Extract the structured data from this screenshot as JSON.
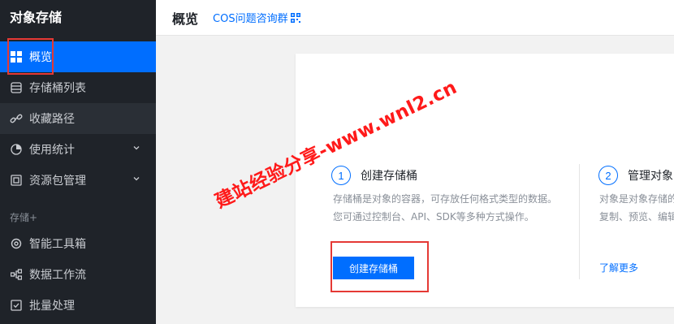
{
  "sidebar": {
    "title": "对象存储",
    "section_label": "存储+",
    "items": [
      {
        "label": "概览",
        "icon": "grid-icon"
      },
      {
        "label": "存储桶列表",
        "icon": "database-icon"
      },
      {
        "label": "收藏路径",
        "icon": "link-icon"
      },
      {
        "label": "使用统计",
        "icon": "pie-chart-icon"
      },
      {
        "label": "资源包管理",
        "icon": "package-icon"
      },
      {
        "label": "智能工具箱",
        "icon": "settings-icon"
      },
      {
        "label": "数据工作流",
        "icon": "workflow-icon"
      },
      {
        "label": "批量处理",
        "icon": "checkbox-icon"
      }
    ]
  },
  "header": {
    "title": "概览",
    "link_label": "COS问题咨询群"
  },
  "steps": [
    {
      "num": "1",
      "title": "创建存储桶",
      "desc_line1": "存储桶是对象的容器，可存放任何格式类型的数据。",
      "desc_line2": "您可通过控制台、API、SDK等多种方式操作。",
      "button_label": "创建存储桶"
    },
    {
      "num": "2",
      "title": "管理对象",
      "desc_line1": "对象是对象存储的",
      "desc_line2": "复制、预览、编辑",
      "link_label": "了解更多"
    }
  ],
  "watermark": "建站经验分享-www.wnl2.cn",
  "colors": {
    "accent": "#006eff",
    "sidebar_bg": "#1f2329",
    "highlight_red": "#e53935",
    "watermark_red": "#ff1a1a"
  }
}
